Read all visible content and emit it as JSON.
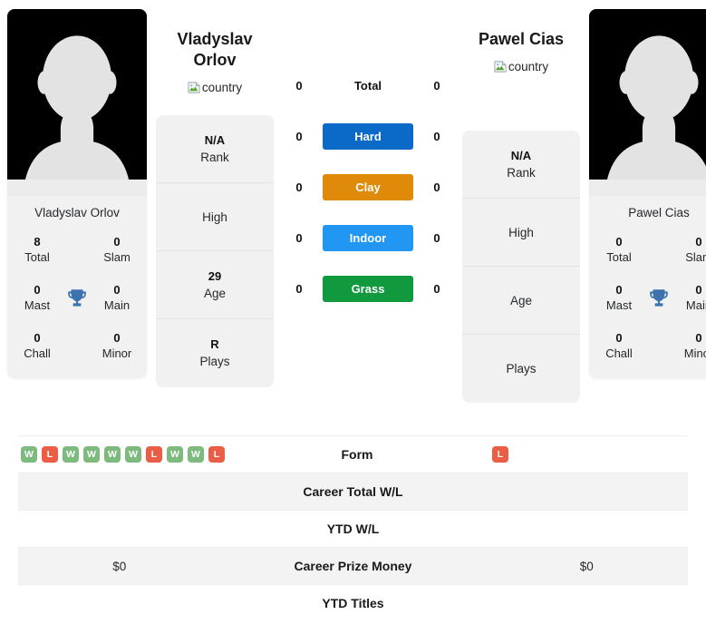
{
  "players": [
    {
      "name": "Vladyslav Orlov",
      "photo_caption": "Vladyslav Orlov",
      "country_alt": "country",
      "titles": [
        {
          "value": "8",
          "label": "Total"
        },
        {
          "value": "0",
          "label": "Slam"
        },
        {
          "value": "0",
          "label": "Mast"
        },
        {
          "value": "0",
          "label": "Main"
        },
        {
          "value": "0",
          "label": "Chall"
        },
        {
          "value": "0",
          "label": "Minor"
        }
      ],
      "info": [
        {
          "value": "N/A",
          "label": "Rank"
        },
        {
          "value": "",
          "label": "High"
        },
        {
          "value": "29",
          "label": "Age"
        },
        {
          "value": "R",
          "label": "Plays"
        }
      ]
    },
    {
      "name": "Pawel Cias",
      "photo_caption": "Pawel Cias",
      "country_alt": "country",
      "titles": [
        {
          "value": "0",
          "label": "Total"
        },
        {
          "value": "0",
          "label": "Slam"
        },
        {
          "value": "0",
          "label": "Mast"
        },
        {
          "value": "0",
          "label": "Main"
        },
        {
          "value": "0",
          "label": "Chall"
        },
        {
          "value": "0",
          "label": "Minor"
        }
      ],
      "info": [
        {
          "value": "N/A",
          "label": "Rank"
        },
        {
          "value": "",
          "label": "High"
        },
        {
          "value": "",
          "label": "Age"
        },
        {
          "value": "",
          "label": "Plays"
        }
      ]
    }
  ],
  "h2h": [
    {
      "label": "Total",
      "left": "0",
      "right": "0",
      "color": ""
    },
    {
      "label": "Hard",
      "left": "0",
      "right": "0",
      "color": "#0b69c7"
    },
    {
      "label": "Clay",
      "left": "0",
      "right": "0",
      "color": "#e08a09"
    },
    {
      "label": "Indoor",
      "left": "0",
      "right": "0",
      "color": "#2196f3"
    },
    {
      "label": "Grass",
      "left": "0",
      "right": "0",
      "color": "#11993e"
    }
  ],
  "table": {
    "rows": [
      {
        "label": "Form",
        "left": "",
        "right": ""
      },
      {
        "label": "Career Total W/L",
        "left": "",
        "right": ""
      },
      {
        "label": "YTD W/L",
        "left": "",
        "right": ""
      },
      {
        "label": "Career Prize Money",
        "left": "$0",
        "right": "$0"
      },
      {
        "label": "YTD Titles",
        "left": "",
        "right": ""
      }
    ],
    "form_left": [
      "W",
      "L",
      "W",
      "W",
      "W",
      "W",
      "L",
      "W",
      "W",
      "L"
    ],
    "form_right": [
      "L"
    ]
  },
  "colors": {
    "win": "#7cba7e",
    "loss": "#ec5d46",
    "panel": "#f1f1f1",
    "stripe": "#f3f3f3"
  },
  "icons": {
    "trophy": "trophy-icon",
    "broken_image": "broken-image-icon"
  }
}
